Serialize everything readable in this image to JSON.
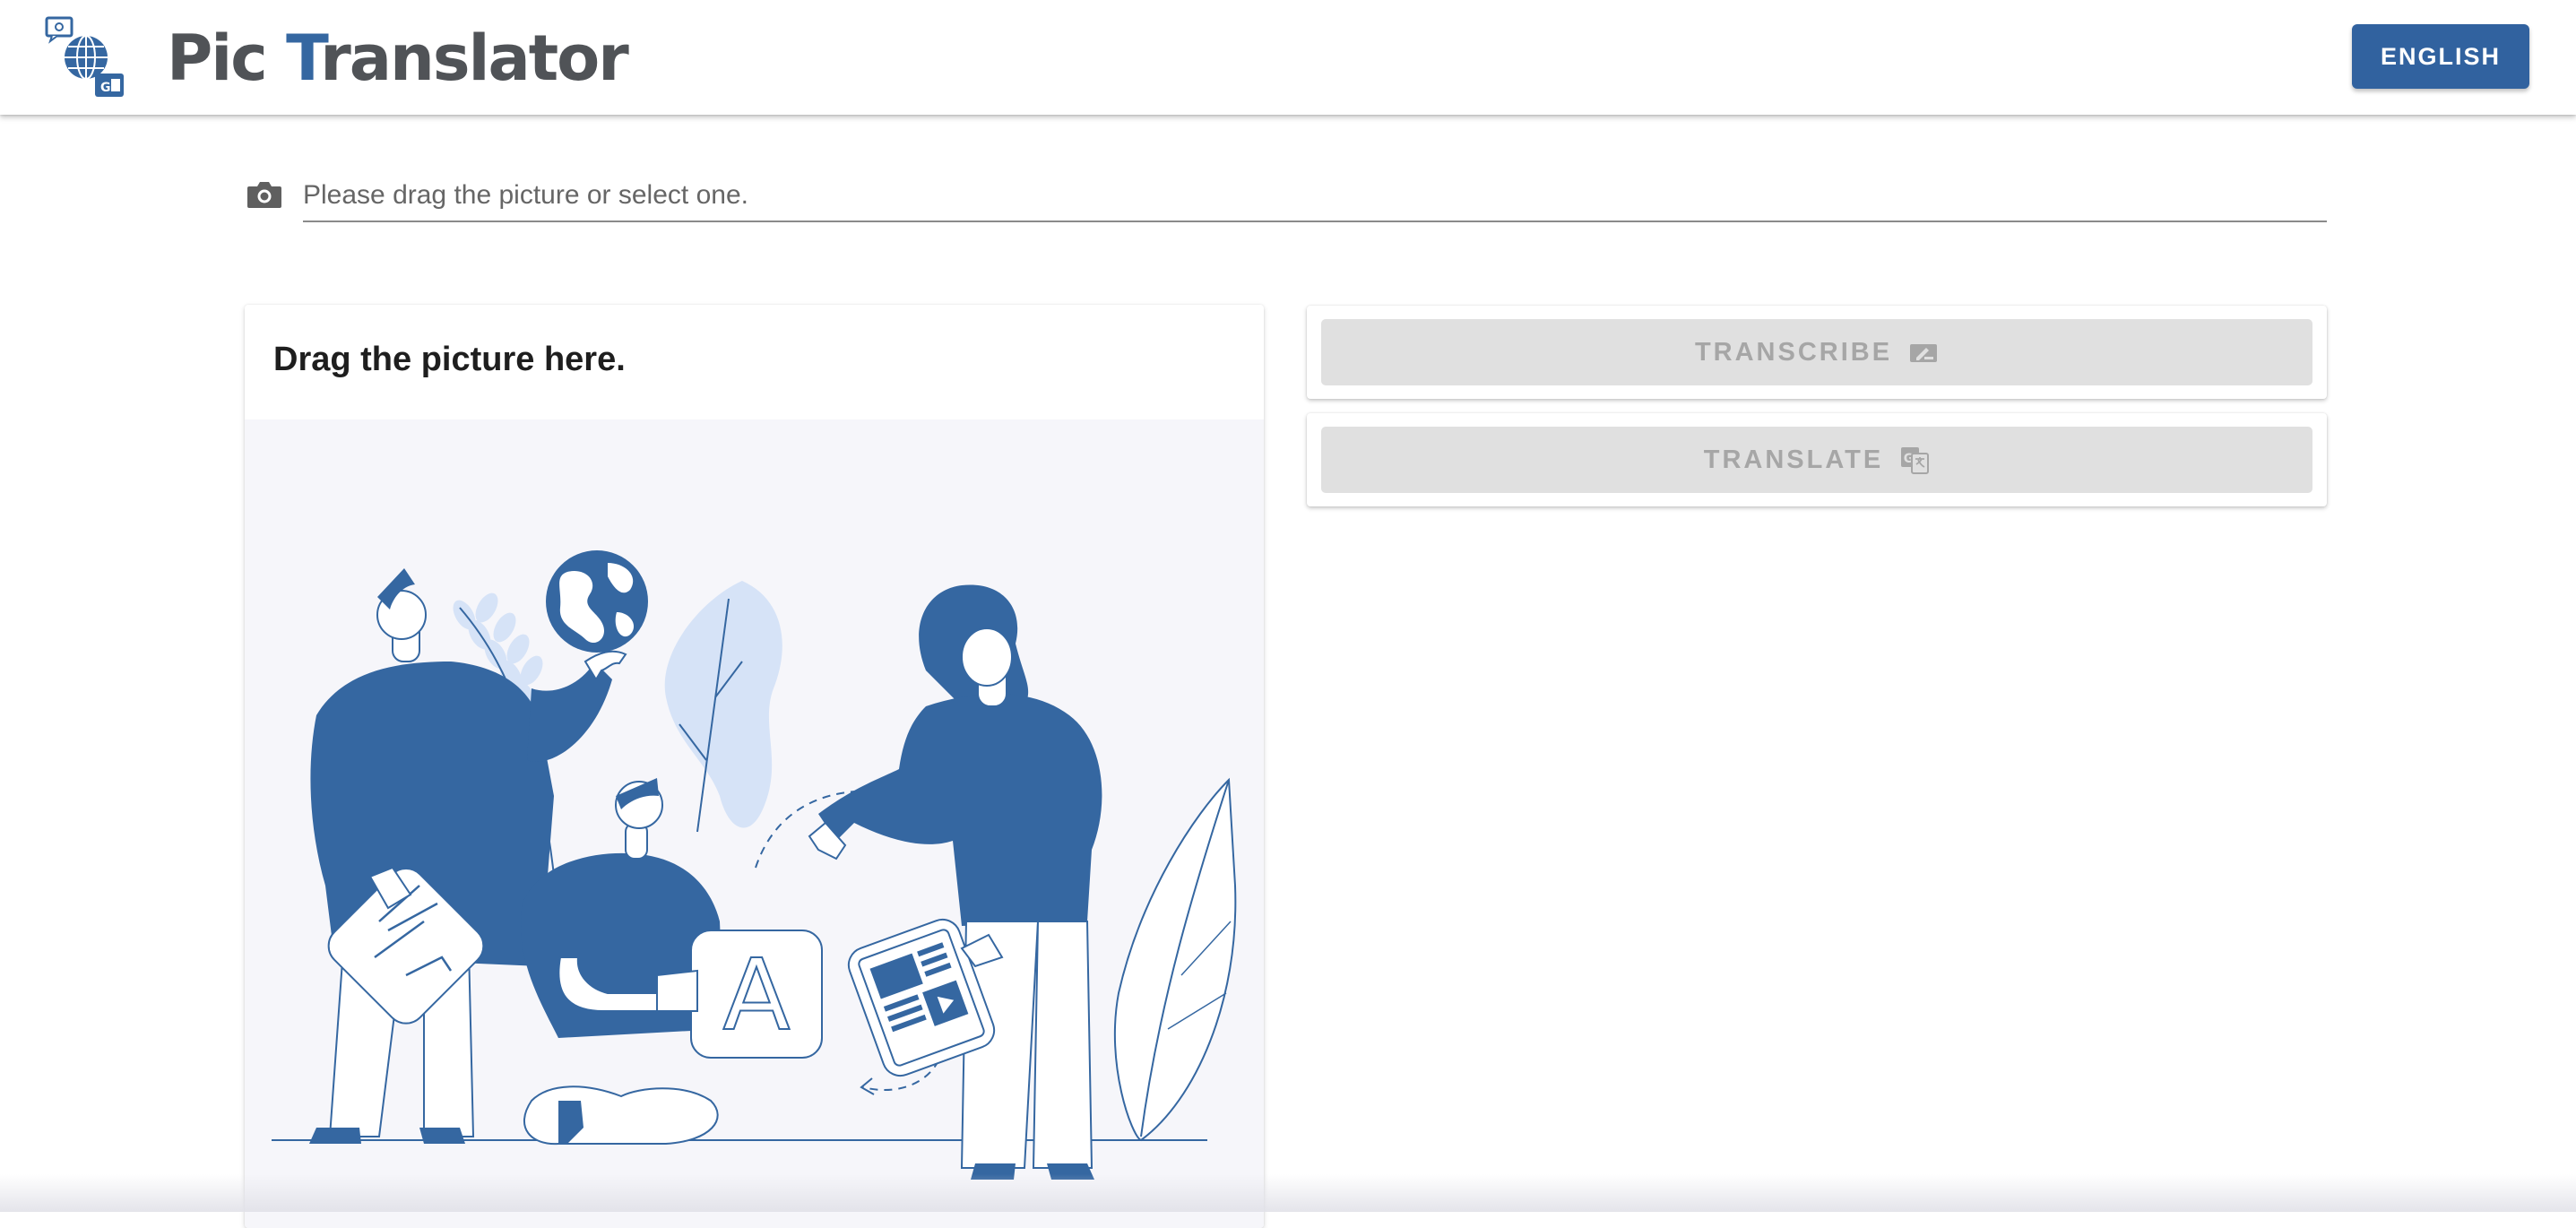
{
  "header": {
    "logo_alt": "Pic Translator logo",
    "title_part1": "Pic",
    "title_accent": "T",
    "title_part2": "ranslator",
    "language_button": "ENGLISH"
  },
  "file_input": {
    "icon": "camera-icon",
    "placeholder": "Please drag the picture or select one."
  },
  "drop_zone": {
    "title": "Drag the picture here.",
    "illustration": "people-translating-illustration"
  },
  "actions": {
    "transcribe": {
      "label": "TRANSCRIBE",
      "icon": "transcribe-icon",
      "disabled": true
    },
    "translate": {
      "label": "TRANSLATE",
      "icon": "translate-icon",
      "disabled": true
    }
  },
  "colors": {
    "brand": "#31629f",
    "title_gray": "#505357",
    "disabled_bg": "#e0e0e0",
    "disabled_text": "#a6a6a6",
    "illustration_blue": "#3567a1",
    "illustration_light": "#d6e3f7"
  }
}
